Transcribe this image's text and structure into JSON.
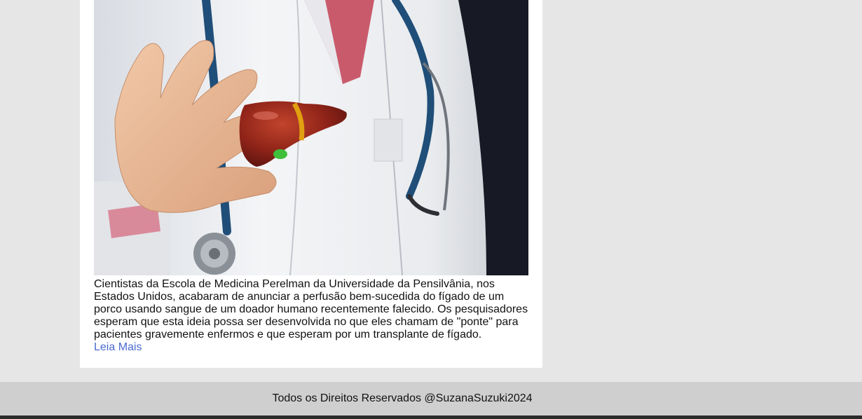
{
  "article": {
    "image_alt": "Médico segurando um modelo de fígado",
    "text": "Cientistas da Escola de Medicina Perelman da Universidade da Pensilvânia, nos Estados Unidos, acabaram de anunciar a perfusão bem-sucedida do fígado de um porco usando sangue de um doador humano recentemente falecido. Os pesquisadores esperam que esta ideia possa ser desenvolvida no que eles chamam de \"ponte\" para pacientes gravemente enfermos e que esperam por um transplante de fígado.",
    "read_more": "Leia Mais"
  },
  "footer": {
    "text": "Todos os Direitos Reservados @SuzanaSuzuki2024"
  },
  "colors": {
    "page_bg": "#e6e6e6",
    "card_bg": "#ffffff",
    "link": "#4a6ad0",
    "footer_bg": "#cfcfcf"
  }
}
